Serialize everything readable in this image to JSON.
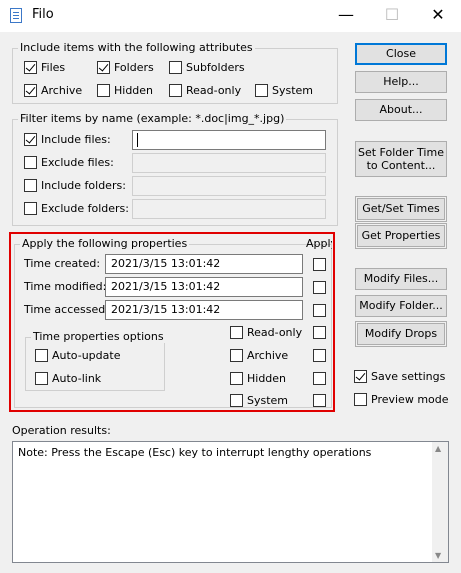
{
  "window": {
    "title": "Filo",
    "minimize": "—",
    "maximize": "☐",
    "close": "✕"
  },
  "attributes_group": {
    "label": "Include items with the following attributes",
    "items": [
      {
        "label": "Files",
        "checked": true
      },
      {
        "label": "Folders",
        "checked": true
      },
      {
        "label": "Subfolders",
        "checked": false
      },
      {
        "label": "Archive",
        "checked": true
      },
      {
        "label": "Hidden",
        "checked": false
      },
      {
        "label": "Read-only",
        "checked": false
      },
      {
        "label": "System",
        "checked": false
      }
    ]
  },
  "filter_group": {
    "label": "Filter items by name (example: *.doc|img_*.jpg)",
    "rows": [
      {
        "label": "Include files:",
        "checked": true,
        "value": "",
        "enabled": true
      },
      {
        "label": "Exclude files:",
        "checked": false,
        "value": "",
        "enabled": false
      },
      {
        "label": "Include folders:",
        "checked": false,
        "value": "",
        "enabled": false
      },
      {
        "label": "Exclude folders:",
        "checked": false,
        "value": "",
        "enabled": false
      }
    ]
  },
  "properties_group": {
    "label": "Apply the following properties",
    "apply_header": "Apply",
    "times": [
      {
        "label": "Time created:",
        "value": "2021/3/15 13:01:42"
      },
      {
        "label": "Time modified:",
        "value": "2021/3/15 13:01:42"
      },
      {
        "label": "Time accessed:",
        "value": "2021/3/15 13:01:42"
      }
    ],
    "options_label": "Time properties options",
    "options": [
      {
        "label": "Auto-update",
        "checked": false
      },
      {
        "label": "Auto-link",
        "checked": false
      }
    ],
    "attributes": [
      {
        "label": "Read-only",
        "checked": false
      },
      {
        "label": "Archive",
        "checked": false
      },
      {
        "label": "Hidden",
        "checked": false
      },
      {
        "label": "System",
        "checked": false
      }
    ]
  },
  "buttons": {
    "close": "Close",
    "help": "Help...",
    "about": "About...",
    "set_folder_time": [
      "Set Folder Time",
      "to Content..."
    ],
    "get_set_times": "Get/Set Times",
    "get_properties": "Get Properties",
    "modify_files": "Modify Files...",
    "modify_folder": "Modify Folder...",
    "modify_drops": "Modify Drops"
  },
  "settings": [
    {
      "label": "Save settings",
      "checked": true
    },
    {
      "label": "Preview mode",
      "checked": false
    }
  ],
  "results": {
    "label": "Operation results:",
    "text": "Note: Press the Escape (Esc) key to interrupt lengthy operations",
    "scroll_up": "▲",
    "scroll_down": "▼"
  },
  "accent_color": "#0078d7",
  "highlight_color": "#e00000"
}
